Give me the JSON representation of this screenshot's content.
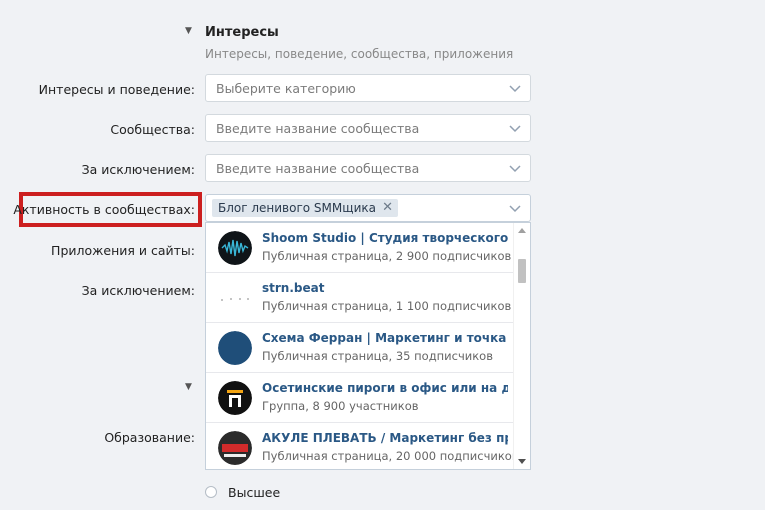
{
  "interests_section": {
    "toggle": "▼",
    "title": "Интересы",
    "subtitle": "Интересы, поведение, сообщества, приложения"
  },
  "form": {
    "interests_label": "Интересы и поведение:",
    "interests_placeholder": "Выберите категорию",
    "communities_label": "Сообщества:",
    "communities_placeholder": "Введите название сообщества",
    "exclude_label": "За исключением:",
    "exclude_placeholder": "Введите название сообщества",
    "activity_label": "Активность в сообществах:",
    "activity_token": "Блог ленивого SMMщика",
    "apps_label": "Приложения и сайты:",
    "apps_exclude_label": "За исключением:"
  },
  "dropdown": {
    "items": [
      {
        "name": "Shoom Studio | Студия творческого раз...",
        "meta": "Публичная страница, 2 900 подписчиков",
        "avatar": "waveform-avatar"
      },
      {
        "name": "strn.beat",
        "meta": "Публичная страница, 1 100 подписчиков",
        "avatar": "dots-avatar"
      },
      {
        "name": "Схема Ферран | Маркетинг и точка без...",
        "meta": "Публичная страница, 35 подписчиков",
        "avatar": "blue-circle-avatar"
      },
      {
        "name": "Осетинские пироги в офис или на дом!",
        "meta": "Группа, 8 900 участников",
        "avatar": "p-logo-avatar"
      },
      {
        "name": "АКУЛЕ ПЛЕВАТЬ / Маркетинг без прав...",
        "meta": "Публичная страница, 20 000 подписчиков",
        "avatar": "akule-avatar"
      }
    ]
  },
  "education": {
    "toggle": "▼",
    "label": "Образование:",
    "option_label": "Высшее"
  },
  "colors": {
    "highlight": "#cc1f1f",
    "link": "#2a5885",
    "background": "#f0f2f5"
  }
}
